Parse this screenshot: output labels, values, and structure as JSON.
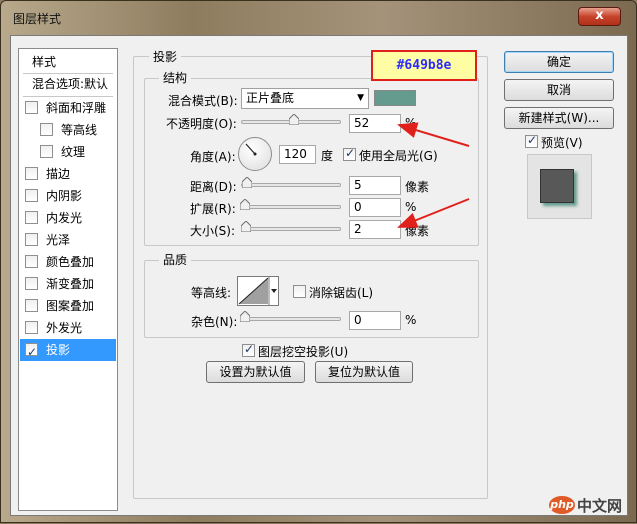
{
  "window": {
    "title": "图层样式",
    "close_label": "x"
  },
  "sidebar": {
    "header": "样式",
    "blend_default": "混合选项:默认",
    "items": [
      {
        "label": "斜面和浮雕",
        "checked": false,
        "sub": false
      },
      {
        "label": "等高线",
        "checked": false,
        "sub": true
      },
      {
        "label": "纹理",
        "checked": false,
        "sub": true
      },
      {
        "label": "描边",
        "checked": false,
        "sub": false
      },
      {
        "label": "内阴影",
        "checked": false,
        "sub": false
      },
      {
        "label": "内发光",
        "checked": false,
        "sub": false
      },
      {
        "label": "光泽",
        "checked": false,
        "sub": false
      },
      {
        "label": "颜色叠加",
        "checked": false,
        "sub": false
      },
      {
        "label": "渐变叠加",
        "checked": false,
        "sub": false
      },
      {
        "label": "图案叠加",
        "checked": false,
        "sub": false
      },
      {
        "label": "外发光",
        "checked": false,
        "sub": false
      },
      {
        "label": "投影",
        "checked": true,
        "sub": false,
        "selected": true
      }
    ]
  },
  "drop_shadow": {
    "title": "投影",
    "structure": {
      "title": "结构",
      "blend_mode_label": "混合模式(B):",
      "blend_mode_value": "正片叠底",
      "shadow_color": "#649b8e",
      "opacity_label": "不透明度(O):",
      "opacity_value": "52",
      "opacity_unit": "%",
      "angle_label": "角度(A):",
      "angle_value": "120",
      "angle_unit": "度",
      "global_light_label": "使用全局光(G)",
      "global_light_checked": true,
      "distance_label": "距离(D):",
      "distance_value": "5",
      "distance_unit": "像素",
      "spread_label": "扩展(R):",
      "spread_value": "0",
      "spread_unit": "%",
      "size_label": "大小(S):",
      "size_value": "2",
      "size_unit": "像素"
    },
    "quality": {
      "title": "品质",
      "contour_label": "等高线:",
      "antialias_label": "消除锯齿(L)",
      "antialias_checked": false,
      "noise_label": "杂色(N):",
      "noise_value": "0",
      "noise_unit": "%"
    },
    "knockout_label": "图层挖空投影(U)",
    "knockout_checked": true,
    "set_default_label": "设置为默认值",
    "reset_default_label": "复位为默认值"
  },
  "buttons": {
    "ok": "确定",
    "cancel": "取消",
    "new_style": "新建样式(W)...",
    "preview_label": "预览(V)",
    "preview_checked": true
  },
  "annotation": {
    "color_code": "#649b8e"
  },
  "watermark": {
    "logo": "php",
    "text": "中文网"
  }
}
